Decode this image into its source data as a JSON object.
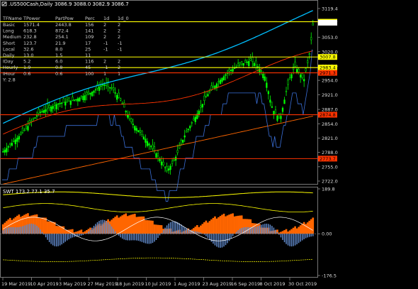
{
  "window": {
    "icon": "chart-window-icon",
    "title": ".US500Cash,Daily",
    "ohlc": "3086.9 3088.0 3082.9 3086.7"
  },
  "info_table": {
    "headers": [
      "TFName",
      "TPower",
      "PartPow",
      "Perc",
      "1d",
      "1d_0"
    ],
    "rows": [
      [
        "Basic",
        "1571.4",
        "2443.8",
        "156",
        "2",
        "2"
      ],
      [
        "Long",
        "618.3",
        "872.4",
        "141",
        "2",
        "2"
      ],
      [
        "Medium",
        "232.8",
        "254.1",
        "109",
        "2",
        "2"
      ],
      [
        "Short",
        "123.7",
        "21.9",
        "17",
        "-1",
        "-1"
      ],
      [
        "Local",
        "32.6",
        "8.0",
        "25",
        "-1",
        "-1"
      ],
      [
        "Daily",
        "13.0",
        "1.5",
        "11",
        "",
        ""
      ],
      [
        "IDay",
        "5.2",
        "6.0",
        "116",
        "2",
        "2"
      ],
      [
        "Hourly",
        "1.9",
        "0.8",
        "45",
        "-1",
        "2"
      ],
      [
        "IHour",
        "0.6",
        "0.6",
        "100",
        "1",
        "1"
      ],
      [
        "",
        "",
        "",
        "",
        "",
        ""
      ]
    ],
    "extra_line": "Y: 2.8"
  },
  "price_axis": {
    "labels": [
      "3119.4",
      "3086.7",
      "3053.0",
      "3020.0",
      "2987.0",
      "2954.0",
      "2921.0",
      "2887.0",
      "2854.0",
      "2821.0",
      "2788.0",
      "2755.0",
      "2722.0"
    ],
    "badges": [
      {
        "text": "3089.0",
        "bg": "#ffff00",
        "fg": "#000000"
      },
      {
        "text": "3007.8",
        "bg": "#ffff00",
        "fg": "#000000"
      },
      {
        "text": "2983.4",
        "bg": "#ffff00",
        "fg": "#000000"
      },
      {
        "text": "2971.3",
        "bg": "#ff3300",
        "fg": "#000000"
      },
      {
        "text": "2874.8",
        "bg": "#ff3300",
        "fg": "#000000"
      },
      {
        "text": "2773.7",
        "bg": "#ff3300",
        "fg": "#000000"
      }
    ]
  },
  "indicator": {
    "title": "SWT 173.2 77.1 35.7",
    "axis": [
      "189.8",
      "0.00",
      "-176.5"
    ]
  },
  "time_axis": [
    "19 Mar 2019",
    "10 Apr 2019",
    "3 May 2019",
    "27 May 2019",
    "18 Jun 2019",
    "10 Jul 2019",
    "1 Aug 2019",
    "23 Aug 2019",
    "16 Sep 2019",
    "8 Oct 2019",
    "30 Oct 2019"
  ],
  "colors": {
    "bull": "#00ff00",
    "cyan": "#00bfff",
    "yellow": "#ffff00",
    "red": "#ff3300",
    "blue_line": "#3a6fd8",
    "orange": "#ff6600",
    "steel": "#5f87c7",
    "grid": "#777777"
  }
}
